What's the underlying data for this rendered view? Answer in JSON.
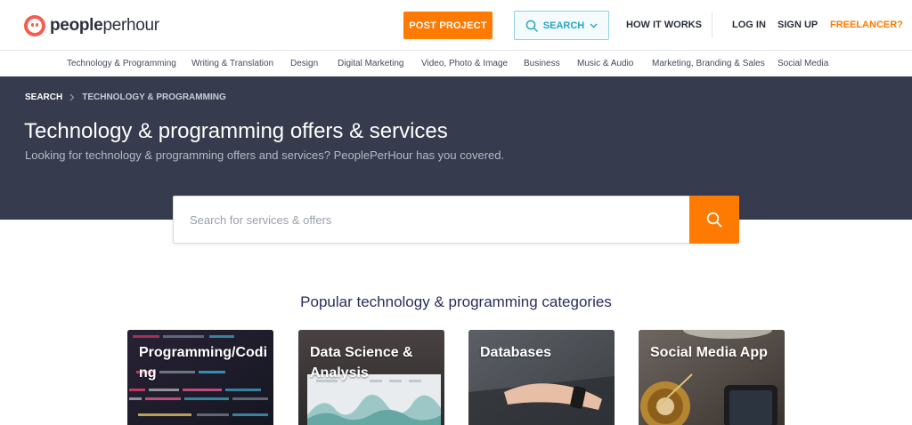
{
  "header": {
    "logo_bold": "people",
    "logo_rest": "perhour",
    "post_project": "POST PROJECT",
    "search": "SEARCH",
    "how_it_works": "HOW IT WORKS",
    "log_in": "LOG IN",
    "sign_up": "SIGN UP",
    "freelancer": "FREELANCER?"
  },
  "categories_nav": [
    "Technology & Programming",
    "Writing & Translation",
    "Design",
    "Digital Marketing",
    "Video, Photo & Image",
    "Business",
    "Music & Audio",
    "Marketing, Branding & Sales",
    "Social Media"
  ],
  "breadcrumb": {
    "root": "SEARCH",
    "current": "TECHNOLOGY & PROGRAMMING"
  },
  "hero": {
    "title": "Technology & programming offers & services",
    "subtitle": "Looking for technology & programming offers and services? PeoplePerHour has you covered."
  },
  "search_box": {
    "placeholder": "Search for services & offers"
  },
  "popular": {
    "title": "Popular technology & programming categories",
    "cards": [
      "Programming/Coding",
      "Data Science & Analysis",
      "Databases",
      "Social Media App"
    ]
  },
  "colors": {
    "accent_orange": "#ff7a00",
    "hero_bg": "#363b4d",
    "search_teal": "#26a6bd",
    "logo_red": "#f45d4f"
  },
  "icons": {
    "logo": "peopleperhour-face-icon",
    "search": "search-icon",
    "dropdown": "chevron-down-icon",
    "breadcrumb_sep": "chevron-right-icon"
  }
}
